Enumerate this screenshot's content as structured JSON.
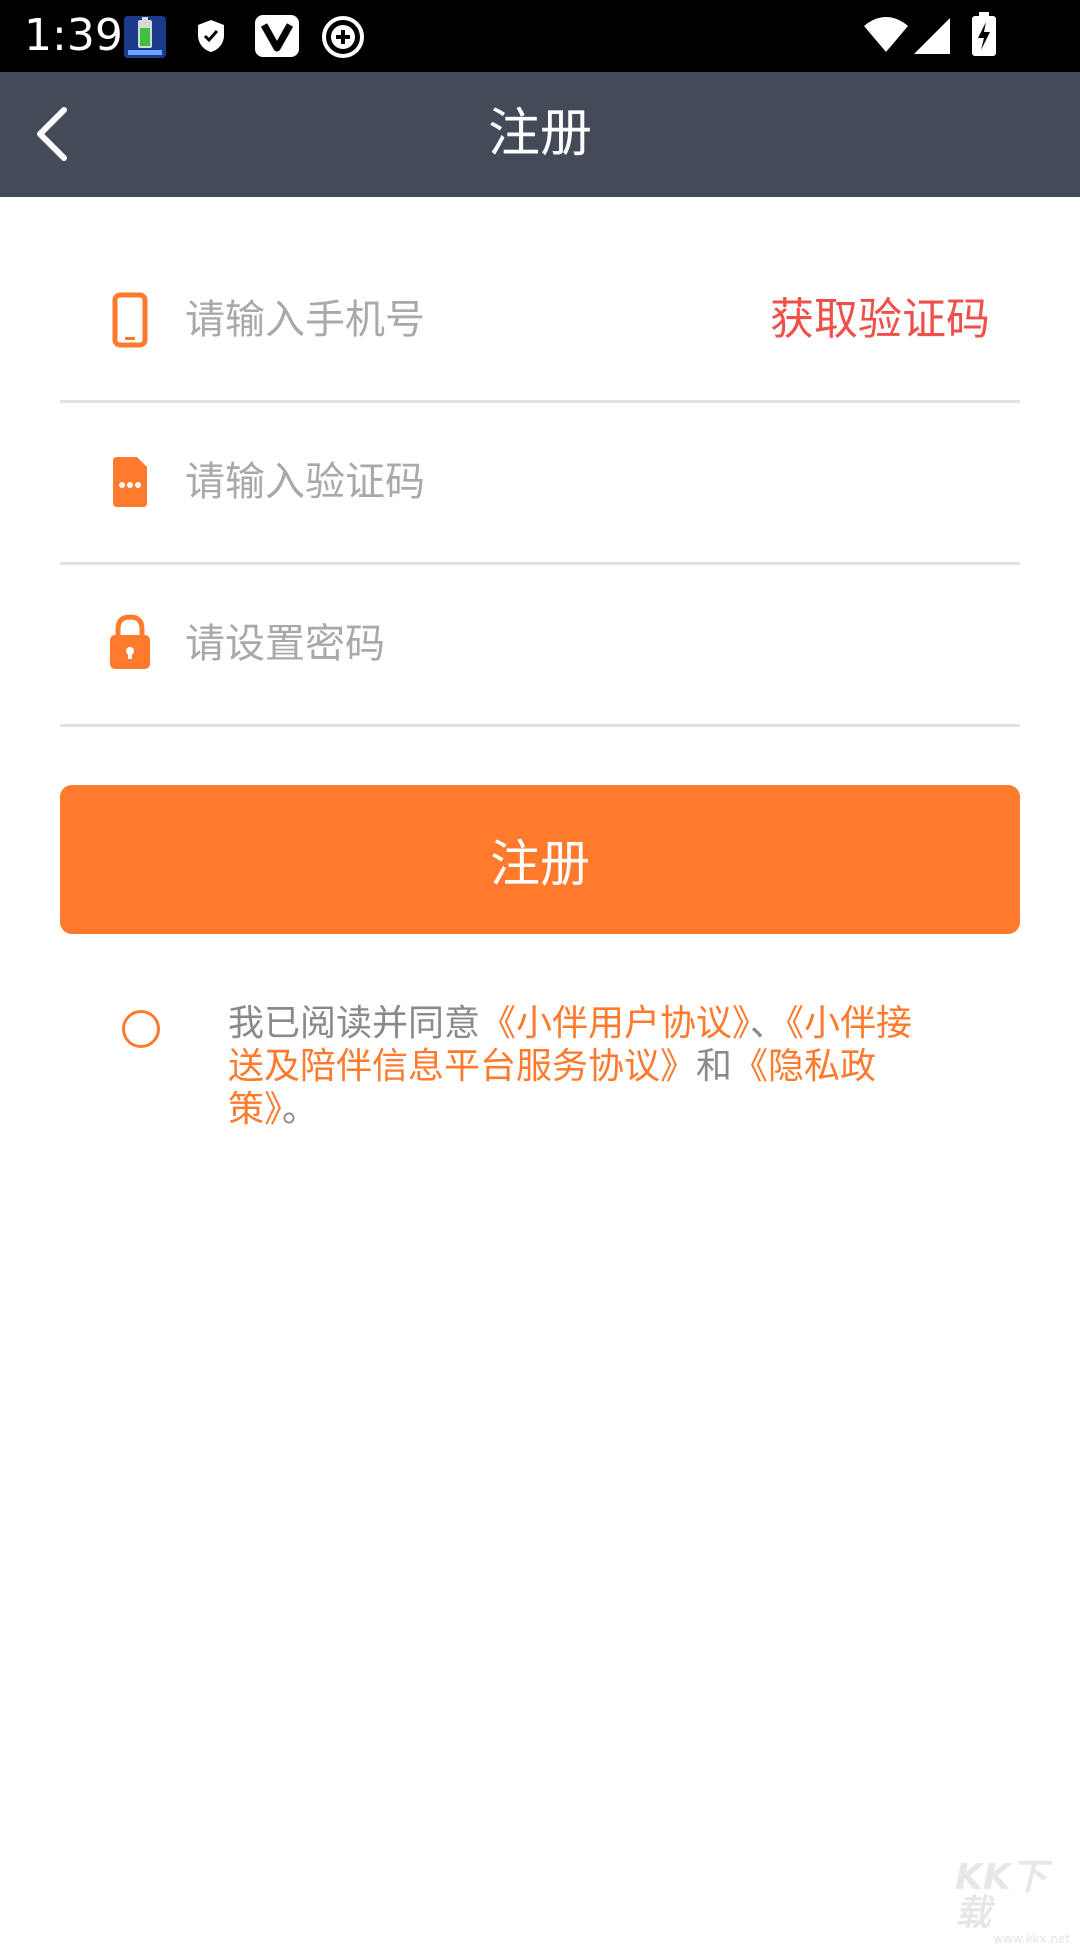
{
  "status_bar": {
    "time": "1:39",
    "icons": [
      "battery-app-icon",
      "shield-icon",
      "vivo-icon",
      "plus-circle-icon",
      "wifi-icon",
      "signal-icon",
      "battery-charging-icon"
    ]
  },
  "header": {
    "title": "注册",
    "back_icon": "chevron-left-icon"
  },
  "form": {
    "phone": {
      "icon": "phone-icon",
      "placeholder": "请输入手机号",
      "value": ""
    },
    "get_code_label": "获取验证码",
    "code": {
      "icon": "message-icon",
      "placeholder": "请输入验证码",
      "value": ""
    },
    "password": {
      "icon": "lock-icon",
      "placeholder": "请设置密码",
      "value": ""
    }
  },
  "register_button_label": "注册",
  "agreement": {
    "prefix": "我已阅读并同意",
    "link1": "《小伴用户协议》",
    "sep1": "、",
    "link2": "《小伴接送及陪伴信息平台服务协议》",
    "sep2": "和",
    "link3": "《隐私政策》",
    "suffix": "。"
  },
  "watermark": {
    "mark": "KK下载",
    "url": "www.kkx.net"
  },
  "colors": {
    "accent": "#ff7a2c",
    "get_code": "#f0504a",
    "header_bg": "#434a58",
    "placeholder": "#a9a9a9"
  }
}
